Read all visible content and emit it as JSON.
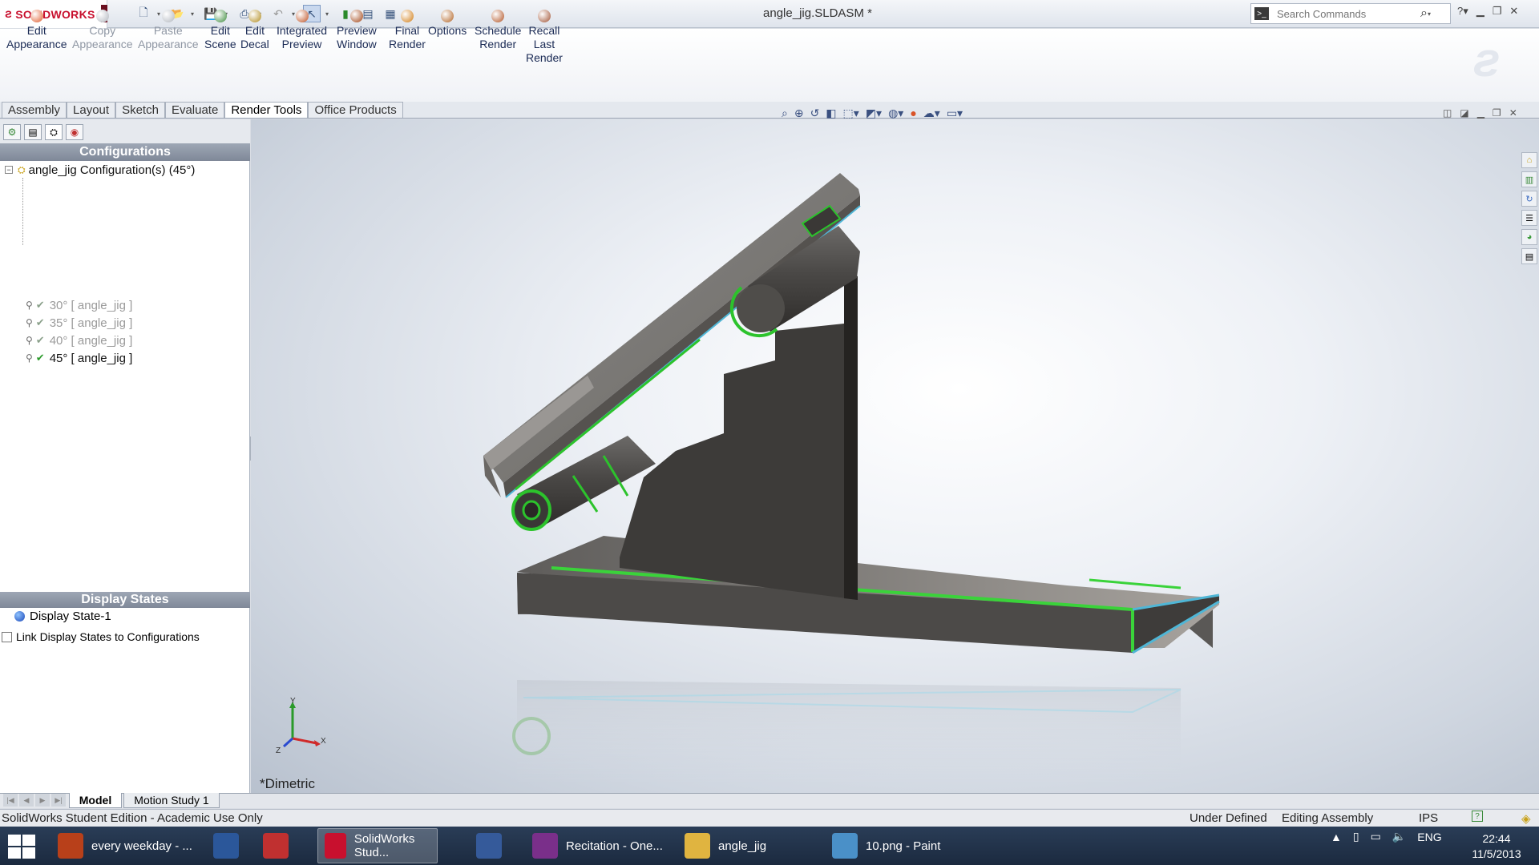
{
  "app": {
    "logo_text": "SOLIDWORKS",
    "document_title": "angle_jig.SLDASM *",
    "search_placeholder": "Search Commands"
  },
  "ribbon": {
    "buttons": [
      {
        "label": "Edit Appearance",
        "l1": "Edit",
        "l2": "Appearance",
        "enabled": true,
        "icon": "appearance-icon",
        "color": "#e05a2a"
      },
      {
        "label": "Copy Appearance",
        "l1": "Copy",
        "l2": "Appearance",
        "enabled": false,
        "icon": "copy-appearance-icon",
        "color": "#b0b5bd"
      },
      {
        "label": "Paste Appearance",
        "l1": "Paste",
        "l2": "Appearance",
        "enabled": false,
        "icon": "paste-appearance-icon",
        "color": "#b0b5bd"
      },
      {
        "label": "Edit Scene",
        "l1": "Edit",
        "l2": "Scene",
        "enabled": true,
        "icon": "scene-icon",
        "color": "#3a8a3a"
      },
      {
        "label": "Edit Decal",
        "l1": "Edit",
        "l2": "Decal",
        "enabled": true,
        "icon": "decal-icon",
        "color": "#b08a1a"
      },
      {
        "label": "Integrated Preview",
        "l1": "Integrated",
        "l2": "Preview",
        "enabled": true,
        "icon": "integrated-preview-icon",
        "color": "#c05020"
      },
      {
        "label": "Preview Window",
        "l1": "Preview",
        "l2": "Window",
        "enabled": true,
        "icon": "preview-window-icon",
        "color": "#a04010"
      },
      {
        "label": "Final Render",
        "l1": "Final",
        "l2": "Render",
        "enabled": true,
        "icon": "final-render-icon",
        "color": "#d07a10"
      },
      {
        "label": "Options",
        "l1": "Options",
        "l2": "",
        "enabled": true,
        "icon": "options-icon",
        "color": "#b06020"
      },
      {
        "label": "Schedule Render",
        "l1": "Schedule",
        "l2": "Render",
        "enabled": true,
        "icon": "schedule-render-icon",
        "color": "#b05020"
      },
      {
        "label": "Recall Last Render",
        "l1": "Recall",
        "l2": "Last",
        "l3": "Render",
        "enabled": true,
        "icon": "recall-render-icon",
        "color": "#a05030"
      }
    ]
  },
  "tabs": [
    "Assembly",
    "Layout",
    "Sketch",
    "Evaluate",
    "Render Tools",
    "Office Products"
  ],
  "active_tab": "Render Tools",
  "config_panel": {
    "title": "Configurations",
    "root": "angle_jig Configuration(s)  (45°)",
    "items": [
      {
        "label": "30° [ angle_jig ]",
        "active": false
      },
      {
        "label": "35° [ angle_jig ]",
        "active": false
      },
      {
        "label": "40° [ angle_jig ]",
        "active": false
      },
      {
        "label": "45° [ angle_jig ]",
        "active": true
      }
    ]
  },
  "display_states": {
    "title": "Display States",
    "item": "Display State-1",
    "link_label": "Link Display States to Configurations"
  },
  "viewport": {
    "view_name": "*Dimetric",
    "triad": {
      "x": "X",
      "y": "Y",
      "z": "Z"
    }
  },
  "bottom_tabs": [
    "Model",
    "Motion Study 1"
  ],
  "status": {
    "left": "SolidWorks Student Edition - Academic Use Only",
    "state": "Under Defined",
    "mode": "Editing Assembly",
    "units": "IPS"
  },
  "taskbar": {
    "items": [
      {
        "label": "every weekday - ...",
        "icon": "firefox-icon",
        "color": "#b8401a"
      },
      {
        "label": "",
        "icon": "word-icon",
        "color": "#2b579a"
      },
      {
        "label": "",
        "icon": "star-app-icon",
        "color": "#c03030"
      },
      {
        "label": "SolidWorks Stud...",
        "icon": "solidworks-icon",
        "color": "#c8102e"
      },
      {
        "label": "",
        "icon": "ds-icon",
        "color": "#355a9a"
      },
      {
        "label": "Recitation - One...",
        "icon": "onenote-icon",
        "color": "#7a2f8a"
      },
      {
        "label": "angle_jig",
        "icon": "folder-icon",
        "color": "#e0b440"
      },
      {
        "label": "10.png - Paint",
        "icon": "paint-icon",
        "color": "#4a90c8"
      }
    ],
    "lang": "ENG",
    "time": "22:44",
    "date": "11/5/2013"
  }
}
